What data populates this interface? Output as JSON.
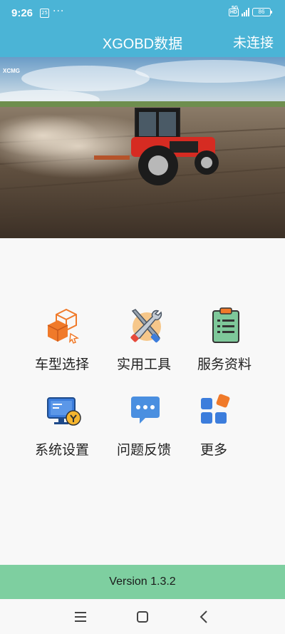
{
  "status": {
    "time": "9:26",
    "badge": "25",
    "dots": "···",
    "hd": "HD",
    "network": "5G",
    "battery": "86"
  },
  "header": {
    "title": "XGOBD数据",
    "connection": "未连接"
  },
  "banner": {
    "logo_text": "XCMG",
    "image": "tractor-field-photo"
  },
  "menu": [
    {
      "label": "车型选择",
      "icon": "cubes-icon"
    },
    {
      "label": "实用工具",
      "icon": "tools-icon"
    },
    {
      "label": "服务资料",
      "icon": "clipboard-icon"
    },
    {
      "label": "系统设置",
      "icon": "settings-monitor-icon"
    },
    {
      "label": "问题反馈",
      "icon": "feedback-chat-icon"
    },
    {
      "label": "更多",
      "icon": "more-apps-icon"
    }
  ],
  "footer": {
    "version": "Version 1.3.2"
  },
  "colors": {
    "header": "#4bb4d6",
    "footer": "#7ecfa0",
    "accent_orange": "#f07a2a",
    "accent_blue": "#3c7ddc"
  }
}
